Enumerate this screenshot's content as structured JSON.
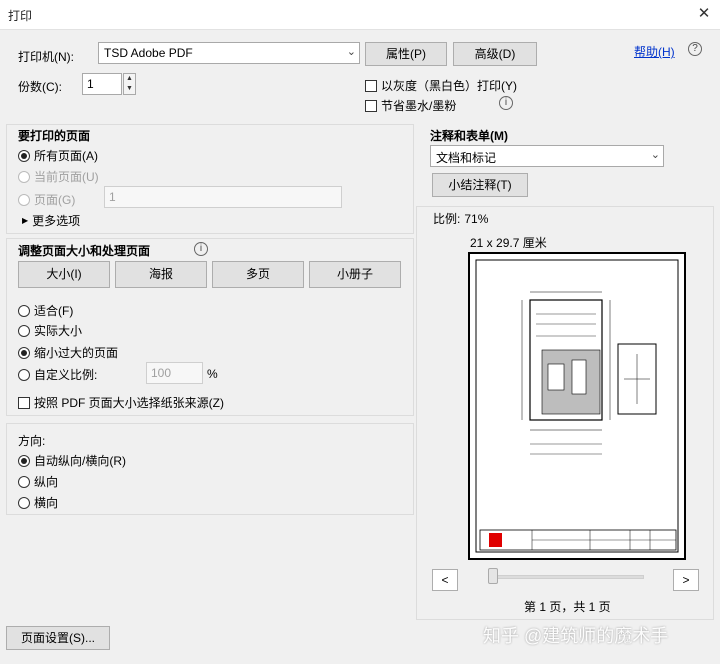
{
  "window": {
    "title": "打印",
    "close_icon": "✕"
  },
  "printer": {
    "label": "打印机(N):",
    "selected": "TSD Adobe PDF",
    "properties_button": "属性(P)",
    "advanced_button": "高级(D)",
    "help_link": "帮助(H)",
    "help_icon": "?"
  },
  "copies": {
    "label": "份数(C):",
    "value": "1"
  },
  "options": {
    "grayscale_label": "以灰度（黑白色）打印(Y)",
    "save_ink_label": "节省墨水/墨粉",
    "info_icon": "i"
  },
  "pages_to_print": {
    "title": "要打印的页面",
    "all_pages": "所有页面(A)",
    "current_page": "当前页面(U)",
    "pages": "页面(G)",
    "pages_value": "1",
    "more_options": "更多选项"
  },
  "annotations": {
    "title": "注释和表单(M)",
    "selected": "文档和标记",
    "summarize_button": "小结注释(T)"
  },
  "page_sizing": {
    "title": "调整页面大小和处理页面",
    "info_icon": "i",
    "tabs": [
      "大小(I)",
      "海报",
      "多页",
      "小册子"
    ],
    "fit": "适合(F)",
    "actual_size": "实际大小",
    "shrink_oversized": "缩小过大的页面",
    "custom_scale": "自定义比例:",
    "custom_scale_value": "100",
    "percent": "%",
    "choose_paper_source": "按照 PDF 页面大小选择纸张来源(Z)"
  },
  "orientation": {
    "title": "方向:",
    "auto": "自动纵向/横向(R)",
    "portrait": "纵向",
    "landscape": "横向"
  },
  "preview": {
    "scale_label": "比例:",
    "scale_value": "71%",
    "paper_size": "21 x 29.7 厘米",
    "prev_icon": "<",
    "next_icon": ">",
    "page_info": "第 1 页，共 1 页"
  },
  "footer": {
    "page_setup_button": "页面设置(S)...",
    "watermark_text": "知乎 @建筑师的魔术手"
  },
  "colors": {
    "accent_link": "#0033cc",
    "stamp_red": "#e00000"
  }
}
